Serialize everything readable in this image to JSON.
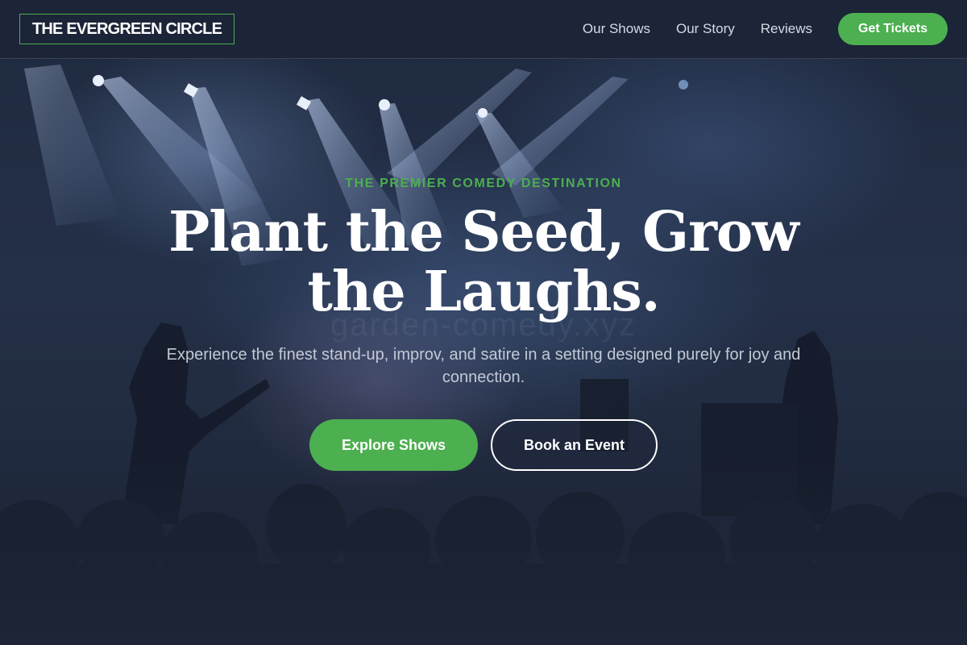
{
  "brand": {
    "logo_text": "THE EVERGREEN CIRCLE",
    "accent_color": "#4caf50",
    "background_color": "#1e2638"
  },
  "nav": {
    "items": [
      {
        "label": "Our Shows"
      },
      {
        "label": "Our Story"
      },
      {
        "label": "Reviews"
      }
    ],
    "cta_label": "Get Tickets"
  },
  "hero": {
    "eyebrow": "THE PREMIER COMEDY DESTINATION",
    "headline": "Plant the Seed, Grow the Laughs.",
    "watermark": "garden-comedy.xyz",
    "subtitle": "Experience the finest stand-up, improv, and satire in a setting designed purely for joy and connection.",
    "primary_button": "Explore Shows",
    "secondary_button": "Book an Event",
    "background_image": "concert-stage-crowd-silhouette"
  }
}
